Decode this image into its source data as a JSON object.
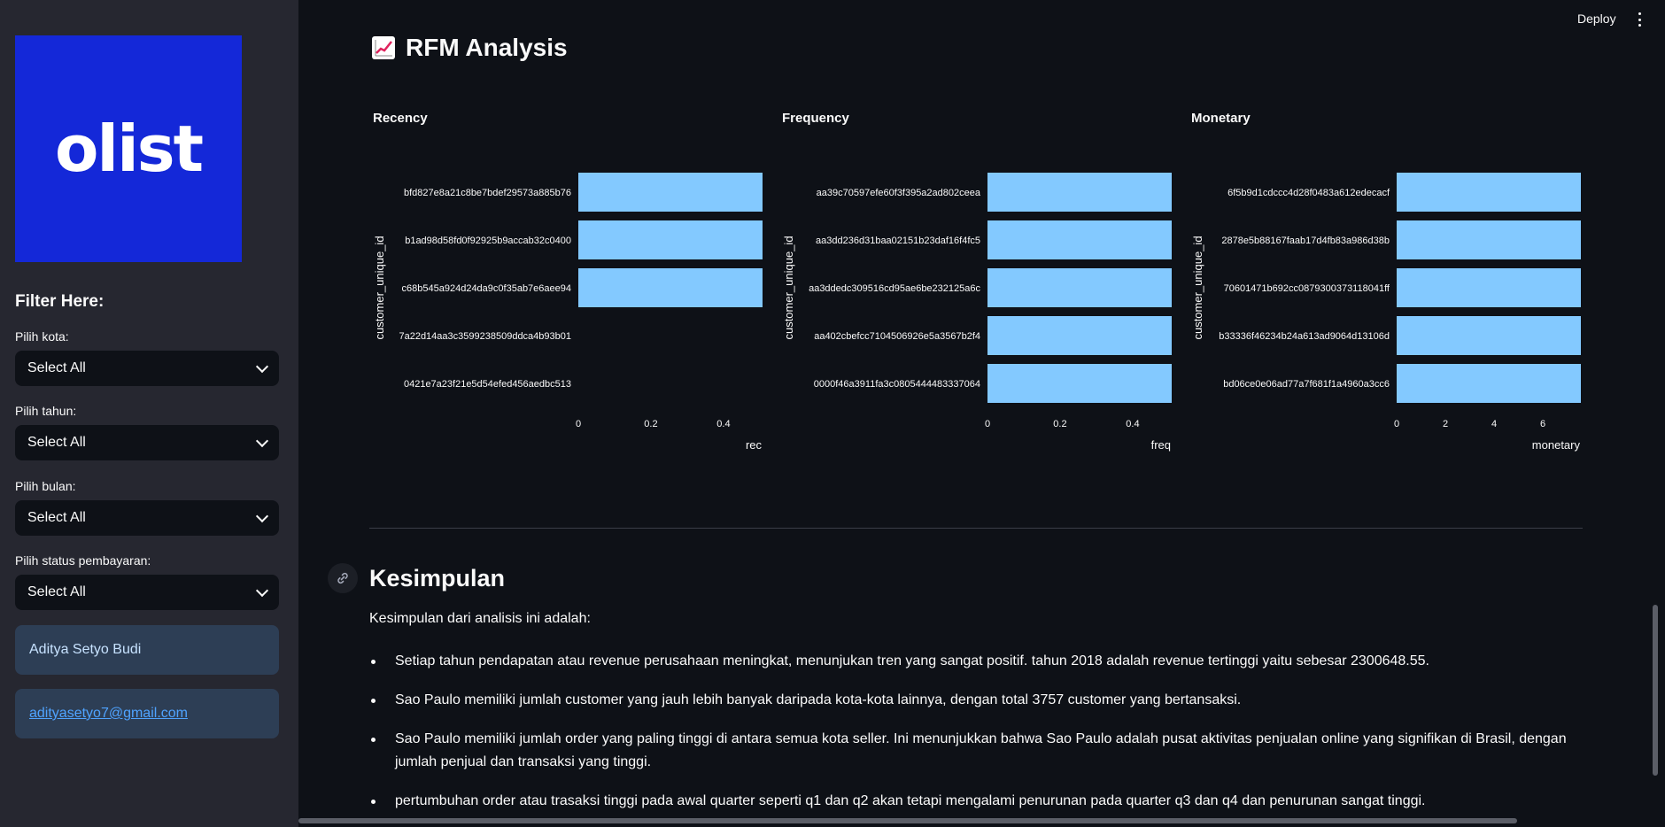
{
  "sidebar": {
    "logo_text": "olist",
    "filter_title": "Filter Here:",
    "filters": [
      {
        "label": "Pilih kota:",
        "value": "Select All"
      },
      {
        "label": "Pilih tahun:",
        "value": "Select All"
      },
      {
        "label": "Pilih bulan:",
        "value": "Select All"
      },
      {
        "label": "Pilih status pembayaran:",
        "value": "Select All"
      }
    ],
    "author": "Aditya Setyo Budi",
    "email": "adityasetyo7@gmail.com"
  },
  "header": {
    "deploy_label": "Deploy"
  },
  "main": {
    "rfm_title": "RFM Analysis",
    "kesimpulan_title": "Kesimpulan",
    "kesimpulan_intro": "Kesimpulan dari analisis ini adalah:",
    "kesimpulan_items": [
      "Setiap tahun pendapatan atau revenue perusahaan meningkat, menunjukan tren yang sangat positif. tahun 2018 adalah revenue tertinggi yaitu sebesar 2300648.55.",
      "Sao Paulo memiliki jumlah customer yang jauh lebih banyak daripada kota-kota lainnya, dengan total 3757 customer yang bertansaksi.",
      "Sao Paulo memiliki jumlah order yang paling tinggi di antara semua kota seller. Ini menunjukkan bahwa Sao Paulo adalah pusat aktivitas penjualan online yang signifikan di Brasil, dengan jumlah penjual dan transaksi yang tinggi.",
      "pertumbuhan order atau trasaksi tinggi pada awal quarter seperti q1 dan q2 akan tetapi mengalami penurunan pada quarter q3 dan q4 dan penurunan sangat tinggi."
    ]
  },
  "colors": {
    "bar": "#83c9ff",
    "logo_bg": "#1428d8",
    "sidebar_bg": "#262730",
    "app_bg": "#0e1117"
  },
  "chart_data": [
    {
      "type": "bar",
      "orientation": "horizontal",
      "title": "Recency",
      "ylabel": "customer_unique_id",
      "xlabel": "rec",
      "categories": [
        "bfd827e8a21c8be7bdef29573a885b76",
        "b1ad98d58fd0f92925b9accab32c0400",
        "c68b545a924d24da9c0f35ab7e6aee94",
        "7a22d14aa3c3599238509ddca4b93b01",
        "0421e7a23f21e5d54efed456aedbc513"
      ],
      "values": [
        1,
        1,
        1,
        0,
        0
      ],
      "xticks": [
        "0",
        "0.2",
        "0.4"
      ],
      "xlim": [
        0,
        0.51
      ]
    },
    {
      "type": "bar",
      "orientation": "horizontal",
      "title": "Frequency",
      "ylabel": "customer_unique_id",
      "xlabel": "freq",
      "categories": [
        "aa39c70597efe60f3f395a2ad802ceea",
        "aa3dd236d31baa02151b23daf16f4fc5",
        "aa3ddedc309516cd95ae6be232125a6c",
        "aa402cbefcc7104506926e5a3567b2f4",
        "0000f46a3911fa3c0805444483337064"
      ],
      "values": [
        1,
        1,
        1,
        1,
        1
      ],
      "xticks": [
        "0",
        "0.2",
        "0.4"
      ],
      "xlim": [
        0,
        0.51
      ]
    },
    {
      "type": "bar",
      "orientation": "horizontal",
      "title": "Monetary",
      "ylabel": "customer_unique_id",
      "xlabel": "monetary",
      "categories": [
        "6f5b9d1cdccc4d28f0483a612edecacf",
        "2878e5b88167faab17d4fb83a986d38b",
        "70601471b692cc0879300373118041ff",
        "b33336f46234b24a613ad9064d13106d",
        "bd06ce0e06ad77a7f681f1a4960a3cc6"
      ],
      "values": [
        7.6,
        7.6,
        7.6,
        7.6,
        7.6
      ],
      "xticks": [
        "0",
        "2",
        "4",
        "6"
      ],
      "xlim": [
        0,
        7.6
      ]
    }
  ]
}
